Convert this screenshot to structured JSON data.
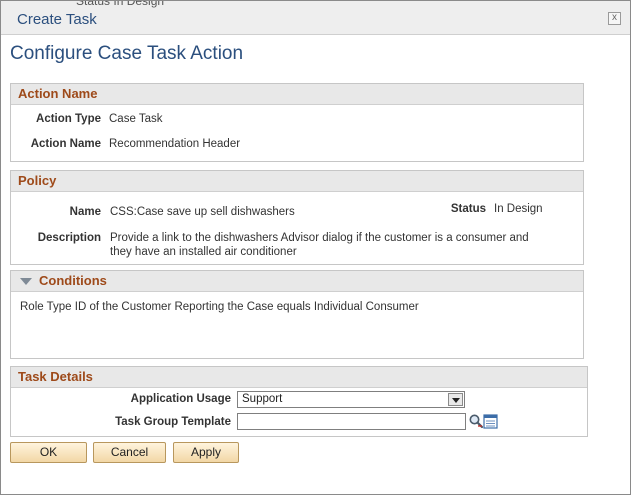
{
  "background": {
    "peek_text": "Status  In Design"
  },
  "dialog": {
    "title": "Create Task",
    "close_label": "x"
  },
  "page_title": "Configure Case Task Action",
  "action_name": {
    "header": "Action Name",
    "fields": [
      {
        "label": "Action Type",
        "value": "Case Task"
      },
      {
        "label": "Action Name",
        "value": "Recommendation Header"
      }
    ]
  },
  "policy": {
    "header": "Policy",
    "name_label": "Name",
    "name_value": "CSS:Case save up sell dishwashers",
    "status_label": "Status",
    "status_value": "In Design",
    "description_label": "Description",
    "description_line1": "Provide a link to the dishwashers Advisor dialog if the customer is a consumer and",
    "description_line2": "they have an installed air conditioner"
  },
  "conditions": {
    "header": "Conditions",
    "text": "Role Type ID of the Customer Reporting the Case equals Individual Consumer"
  },
  "task_details": {
    "header": "Task Details",
    "application_usage_label": "Application Usage",
    "application_usage_value": "Support",
    "task_group_template_label": "Task Group Template",
    "task_group_template_value": ""
  },
  "buttons": {
    "ok": "OK",
    "cancel": "Cancel",
    "apply": "Apply"
  },
  "colors": {
    "title_blue": "#2b4f7e",
    "section_header_text": "#9e4a1a",
    "section_header_bg": "#e8e8e8",
    "button_bg": "#f2d7a6"
  }
}
